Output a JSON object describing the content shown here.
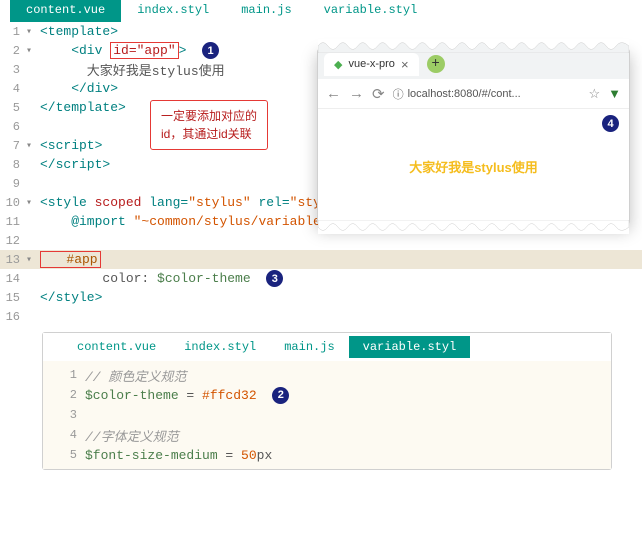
{
  "main": {
    "tabs": [
      "content.vue",
      "index.styl",
      "main.js",
      "variable.styl"
    ],
    "activeTab": 0,
    "lines": {
      "l1": "<template>",
      "l2a": "    <div ",
      "l2b": "id=\"app\"",
      "l2c": ">",
      "l3": "      大家好我是stylus使用",
      "l4": "    </div>",
      "l5": "</template>",
      "l7": "<script>",
      "l8": "</script>",
      "l10a": "<style ",
      "l10b": "scoped",
      "l10c": " lang=",
      "l10d": "\"stylus\"",
      "l10e": " rel=",
      "l10f": "\"stylesheet/stylus\"",
      "l10g": ">",
      "l11a": "    @import ",
      "l11b": "\"~common/stylus/variable.styl\"",
      "l13": "   #app",
      "l14a": "        color: ",
      "l14b": "$color-theme",
      "l15": "</style>"
    },
    "callout": "一定要添加对应的\nid，其通过id关联"
  },
  "browser": {
    "tabTitle": "vue-x-pro",
    "url": "localhost:8080/#/cont...",
    "bodyText": "大家好我是stylus使用"
  },
  "sub": {
    "tabs": [
      "content.vue",
      "index.styl",
      "main.js",
      "variable.styl"
    ],
    "activeTab": 3,
    "lines": {
      "l1": "// 颜色定义规范",
      "l2a": "$color-theme",
      "l2b": " = ",
      "l2c": "#ffcd32",
      "l4": "//字体定义规范",
      "l5a": "$font-size-medium",
      "l5b": " = ",
      "l5c": "50",
      "l5d": "px"
    }
  },
  "badges": {
    "b1": "1",
    "b2": "2",
    "b3": "3",
    "b4": "4"
  }
}
